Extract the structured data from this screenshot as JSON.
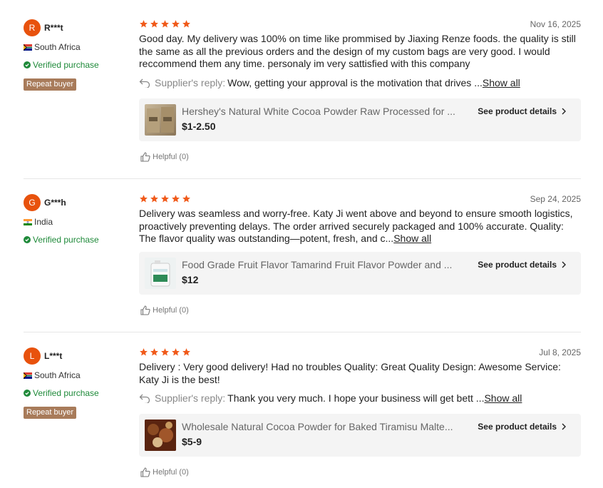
{
  "reviews": [
    {
      "avatar_letter": "R",
      "user": "R***t",
      "country": "South Africa",
      "verified": "Verified purchase",
      "badge": "Repeat buyer",
      "date": "Nov 16, 2025",
      "rating": 5,
      "text": "Good day. My delivery was 100% on time like prommised by Jiaxing Renze foods. the quality is still the same as all the previous orders and the design of my custom bags are very good. I would reccommend them any time. personaly im very sattisfied with this company",
      "show_all": "Show all",
      "reply_label": "Supplier's reply:",
      "reply_text": "Wow, getting your approval is the motivation that drives ...",
      "product_title": "Hershey's Natural White Cocoa Powder Raw Processed for ...",
      "product_price": "$1-2.50",
      "product_link": "See product details",
      "helpful": "Helpful (0)"
    },
    {
      "avatar_letter": "G",
      "user": "G***h",
      "country": "India",
      "verified": "Verified purchase",
      "date": "Sep 24, 2025",
      "rating": 5,
      "text": "Delivery was seamless and worry-free. Katy Ji went above and beyond to ensure smooth logistics, proactively preventing delays. The order arrived securely packaged and 100% accurate. Quality:    The flavor quality was outstanding—potent, fresh, and c...",
      "show_all": "Show all",
      "product_title": "Food Grade Fruit Flavor Tamarind Fruit Flavor Powder and ...",
      "product_price": "$12",
      "product_link": "See product details",
      "helpful": "Helpful (0)"
    },
    {
      "avatar_letter": "L",
      "user": "L***t",
      "country": "South Africa",
      "verified": "Verified purchase",
      "badge": "Repeat buyer",
      "date": "Jul 8, 2025",
      "rating": 5,
      "text": "Delivery : Very good delivery! Had no troubles Quality: Great Quality Design: Awesome Service: Katy Ji is the best!",
      "reply_label": "Supplier's reply:",
      "reply_text": "Thank you very much. I hope your business will get bett ...",
      "show_all": "Show all",
      "product_title": "Wholesale Natural Cocoa Powder for Baked Tiramisu Malte...",
      "product_price": "$5-9",
      "product_link": "See product details",
      "helpful": "Helpful (0)"
    }
  ],
  "colors": {
    "accent": "#e8520d",
    "star": "#f05a1a",
    "verified": "#1f8a3a",
    "badge": "#a87b5a"
  }
}
